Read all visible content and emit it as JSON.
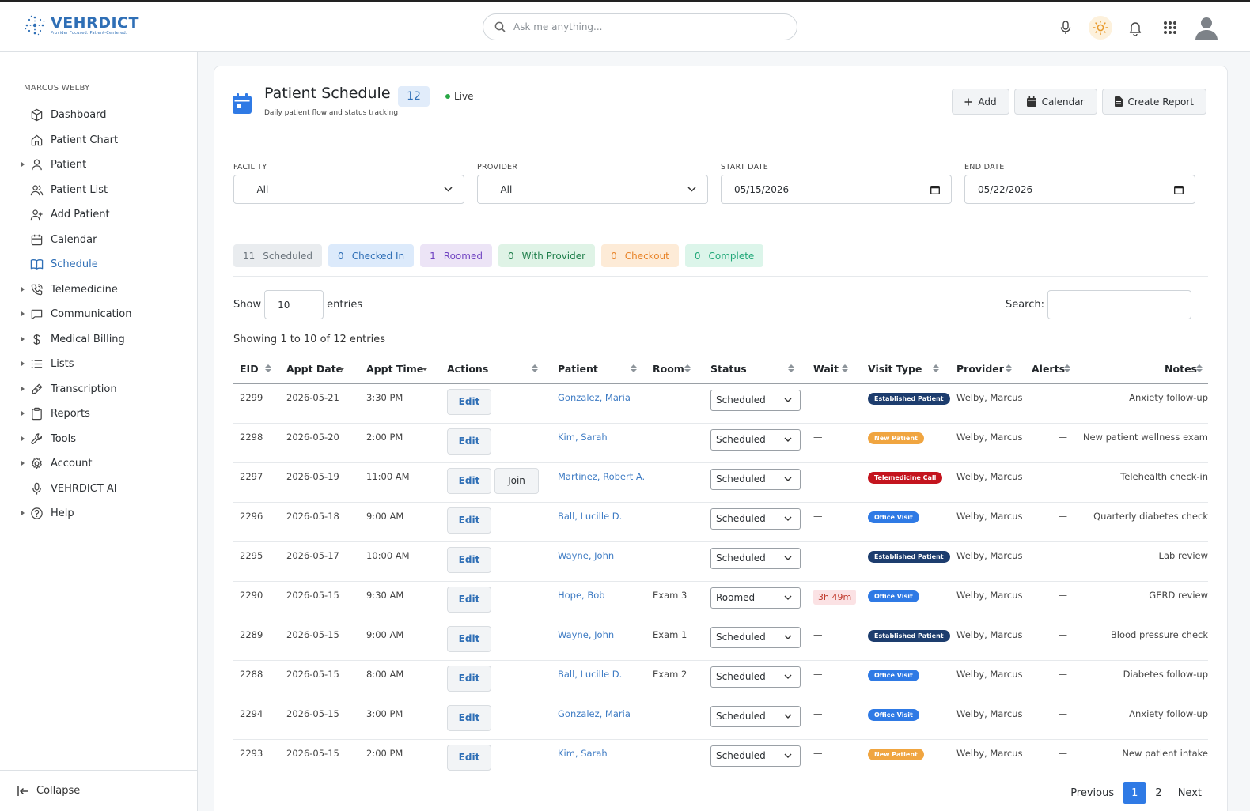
{
  "app": {
    "name": "VEHRDICT",
    "tagline": "Provider Focused. Patient-Centered.",
    "search_placeholder": "Ask me anything..."
  },
  "colors": {
    "accent": "#2f6fb6",
    "established": "#1d3d6e",
    "new_patient": "#f0a540",
    "telemedicine": "#c4141e",
    "office_visit": "#2f7ae5"
  },
  "sidebar": {
    "user": "MARCUS WELBY",
    "items": [
      {
        "label": "Dashboard",
        "icon": "cube-icon",
        "caret": false
      },
      {
        "label": "Patient Chart",
        "icon": "home-icon",
        "caret": false
      },
      {
        "label": "Patient",
        "icon": "user-icon",
        "caret": true
      },
      {
        "label": "Patient List",
        "icon": "users-icon",
        "caret": false
      },
      {
        "label": "Add Patient",
        "icon": "user-plus-icon",
        "caret": false
      },
      {
        "label": "Calendar",
        "icon": "calendar-icon",
        "caret": false
      },
      {
        "label": "Schedule",
        "icon": "book-icon",
        "caret": false,
        "active": true
      },
      {
        "label": "Telemedicine",
        "icon": "phone-icon",
        "caret": true
      },
      {
        "label": "Communication",
        "icon": "message-icon",
        "caret": true
      },
      {
        "label": "Medical Billing",
        "icon": "dollar-icon",
        "caret": true
      },
      {
        "label": "Lists",
        "icon": "list-icon",
        "caret": true
      },
      {
        "label": "Transcription",
        "icon": "pen-icon",
        "caret": true
      },
      {
        "label": "Reports",
        "icon": "clipboard-icon",
        "caret": true
      },
      {
        "label": "Tools",
        "icon": "wrench-icon",
        "caret": true
      },
      {
        "label": "Account",
        "icon": "gear-icon",
        "caret": true
      },
      {
        "label": "VEHRDICT AI",
        "icon": "mic-icon",
        "caret": false
      },
      {
        "label": "Help",
        "icon": "help-icon",
        "caret": true
      }
    ],
    "collapse_label": "Collapse"
  },
  "page": {
    "title": "Patient Schedule",
    "count": "12",
    "live_label": "Live",
    "subtitle": "Daily patient flow and status tracking",
    "buttons": {
      "add": "Add",
      "calendar": "Calendar",
      "report": "Create Report"
    }
  },
  "filters": {
    "facility_label": "FACILITY",
    "facility_value": "-- All --",
    "provider_label": "PROVIDER",
    "provider_value": "-- All --",
    "start_label": "START DATE",
    "start_value": "05/15/2026",
    "end_label": "END DATE",
    "end_value": "05/22/2026"
  },
  "status_chips": [
    {
      "count": "11",
      "label": "Scheduled",
      "bg": "#e9ecef",
      "fg": "#6c757d"
    },
    {
      "count": "0",
      "label": "Checked In",
      "bg": "#dceafb",
      "fg": "#2f6fb6"
    },
    {
      "count": "1",
      "label": "Roomed",
      "bg": "#ece4f6",
      "fg": "#6f42c1"
    },
    {
      "count": "0",
      "label": "With Provider",
      "bg": "#dff3e6",
      "fg": "#1e7e4a"
    },
    {
      "count": "0",
      "label": "Checkout",
      "bg": "#fdebd7",
      "fg": "#e8842a"
    },
    {
      "count": "0",
      "label": "Complete",
      "bg": "#dcf5ea",
      "fg": "#20a878"
    }
  ],
  "table_controls": {
    "show_label": "Show",
    "entries_value": "10",
    "entries_label": "entries",
    "search_label": "Search:",
    "showing": "Showing 1 to 10 of 12 entries"
  },
  "table": {
    "columns": [
      "EID",
      "Appt Date",
      "Appt Time",
      "Actions",
      "Patient",
      "Room",
      "Status",
      "Wait",
      "Visit Type",
      "Provider",
      "Alerts",
      "Notes"
    ],
    "edit_label": "Edit",
    "join_label": "Join",
    "rows": [
      {
        "eid": "2299",
        "date": "2026-05-21",
        "time": "3:30 PM",
        "join": false,
        "patient": "Gonzalez, Maria",
        "room": "",
        "status": "Scheduled",
        "wait": "—",
        "wait_alert": false,
        "visit": "Established Patient",
        "visit_color": "#1d3d6e",
        "provider": "Welby, Marcus",
        "alerts": "—",
        "notes": "Anxiety follow-up"
      },
      {
        "eid": "2298",
        "date": "2026-05-20",
        "time": "2:00 PM",
        "join": false,
        "patient": "Kim, Sarah",
        "room": "",
        "status": "Scheduled",
        "wait": "—",
        "wait_alert": false,
        "visit": "New Patient",
        "visit_color": "#f0a540",
        "provider": "Welby, Marcus",
        "alerts": "—",
        "notes": "New patient wellness exam"
      },
      {
        "eid": "2297",
        "date": "2026-05-19",
        "time": "11:00 AM",
        "join": true,
        "patient": "Martinez, Robert A.",
        "room": "",
        "status": "Scheduled",
        "wait": "—",
        "wait_alert": false,
        "visit": "Telemedicine Call",
        "visit_color": "#c4141e",
        "provider": "Welby, Marcus",
        "alerts": "—",
        "notes": "Telehealth check-in"
      },
      {
        "eid": "2296",
        "date": "2026-05-18",
        "time": "9:00 AM",
        "join": false,
        "patient": "Ball, Lucille D.",
        "room": "",
        "status": "Scheduled",
        "wait": "—",
        "wait_alert": false,
        "visit": "Office Visit",
        "visit_color": "#2f7ae5",
        "provider": "Welby, Marcus",
        "alerts": "—",
        "notes": "Quarterly diabetes check"
      },
      {
        "eid": "2295",
        "date": "2026-05-17",
        "time": "10:00 AM",
        "join": false,
        "patient": "Wayne, John",
        "room": "",
        "status": "Scheduled",
        "wait": "—",
        "wait_alert": false,
        "visit": "Established Patient",
        "visit_color": "#1d3d6e",
        "provider": "Welby, Marcus",
        "alerts": "—",
        "notes": "Lab review"
      },
      {
        "eid": "2290",
        "date": "2026-05-15",
        "time": "9:30 AM",
        "join": false,
        "patient": "Hope, Bob",
        "room": "Exam 3",
        "status": "Roomed",
        "wait": "3h 49m",
        "wait_alert": true,
        "visit": "Office Visit",
        "visit_color": "#2f7ae5",
        "provider": "Welby, Marcus",
        "alerts": "—",
        "notes": "GERD review"
      },
      {
        "eid": "2289",
        "date": "2026-05-15",
        "time": "9:00 AM",
        "join": false,
        "patient": "Wayne, John",
        "room": "Exam 1",
        "status": "Scheduled",
        "wait": "—",
        "wait_alert": false,
        "visit": "Established Patient",
        "visit_color": "#1d3d6e",
        "provider": "Welby, Marcus",
        "alerts": "—",
        "notes": "Blood pressure check"
      },
      {
        "eid": "2288",
        "date": "2026-05-15",
        "time": "8:00 AM",
        "join": false,
        "patient": "Ball, Lucille D.",
        "room": "Exam 2",
        "status": "Scheduled",
        "wait": "—",
        "wait_alert": false,
        "visit": "Office Visit",
        "visit_color": "#2f7ae5",
        "provider": "Welby, Marcus",
        "alerts": "—",
        "notes": "Diabetes follow-up"
      },
      {
        "eid": "2294",
        "date": "2026-05-15",
        "time": "3:00 PM",
        "join": false,
        "patient": "Gonzalez, Maria",
        "room": "",
        "status": "Scheduled",
        "wait": "—",
        "wait_alert": false,
        "visit": "Office Visit",
        "visit_color": "#2f7ae5",
        "provider": "Welby, Marcus",
        "alerts": "—",
        "notes": "Anxiety follow-up"
      },
      {
        "eid": "2293",
        "date": "2026-05-15",
        "time": "2:00 PM",
        "join": false,
        "patient": "Kim, Sarah",
        "room": "",
        "status": "Scheduled",
        "wait": "—",
        "wait_alert": false,
        "visit": "New Patient",
        "visit_color": "#f0a540",
        "provider": "Welby, Marcus",
        "alerts": "—",
        "notes": "New patient intake"
      }
    ]
  },
  "pagination": {
    "previous": "Previous",
    "pages": [
      "1",
      "2"
    ],
    "current": "1",
    "next": "Next"
  }
}
